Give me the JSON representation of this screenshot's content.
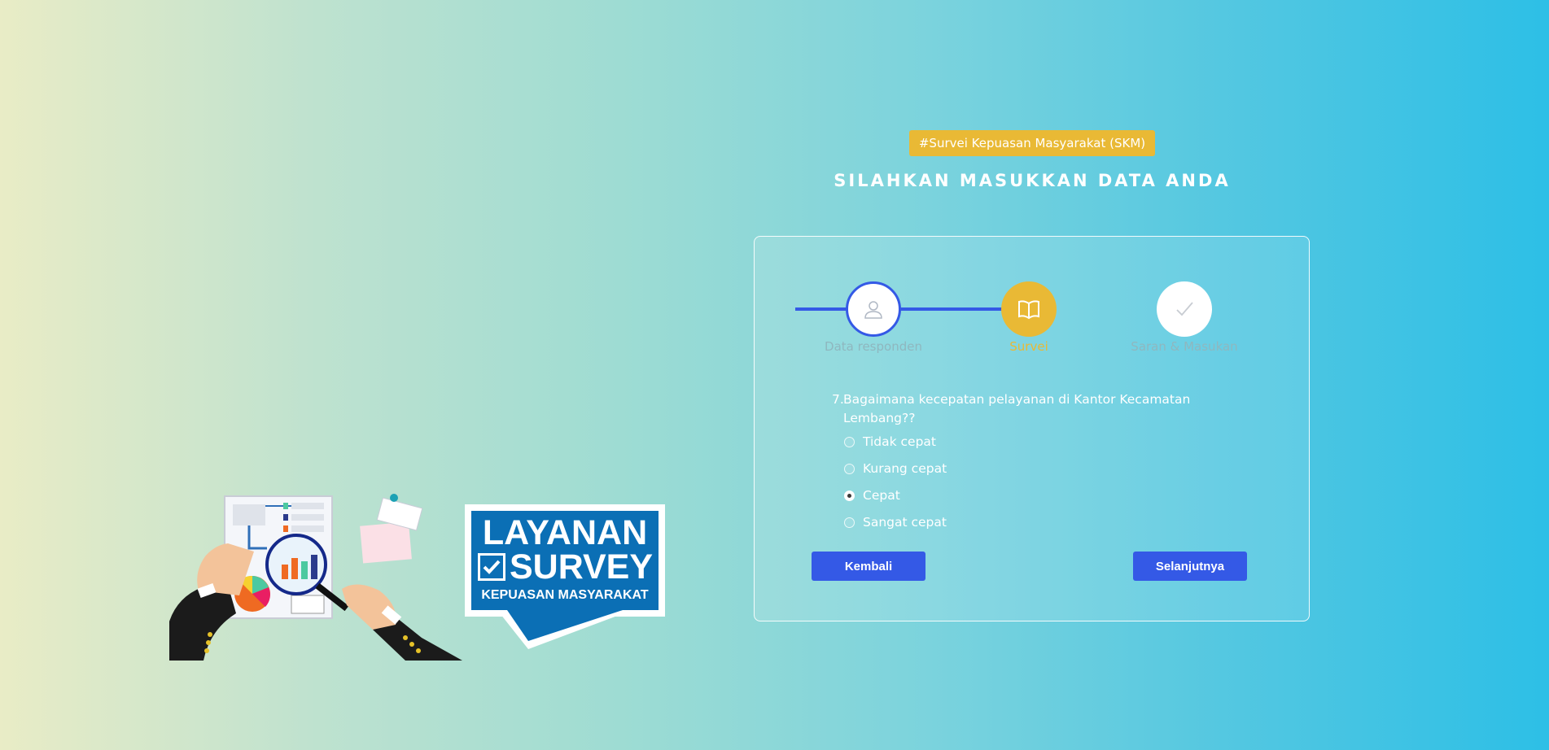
{
  "tag": "#Survei Kepuasan Masyarakat (SKM)",
  "heading": "SILAHKAN MASUKKAN DATA ANDA",
  "steps": [
    {
      "label": "Data responden",
      "icon": "user-icon",
      "state": "done"
    },
    {
      "label": "Survei",
      "icon": "book-icon",
      "state": "active"
    },
    {
      "label": "Saran & Masukan",
      "icon": "check-icon",
      "state": "pending"
    }
  ],
  "question": {
    "number": "7.",
    "text": "Bagaimana kecepatan pelayanan di Kantor Kecamatan Lembang??"
  },
  "options": [
    {
      "label": "Tidak cepat",
      "selected": false
    },
    {
      "label": "Kurang cepat",
      "selected": false
    },
    {
      "label": "Cepat",
      "selected": true
    },
    {
      "label": "Sangat cepat",
      "selected": false
    }
  ],
  "buttons": {
    "back": "Kembali",
    "next": "Selanjutnya"
  },
  "logo": {
    "line1": "LAYANAN",
    "line2": "SURVEY",
    "line3": "KEPUASAN MASYARAKAT"
  },
  "colors": {
    "accent": "#3459e6",
    "highlight": "#e9b935"
  }
}
